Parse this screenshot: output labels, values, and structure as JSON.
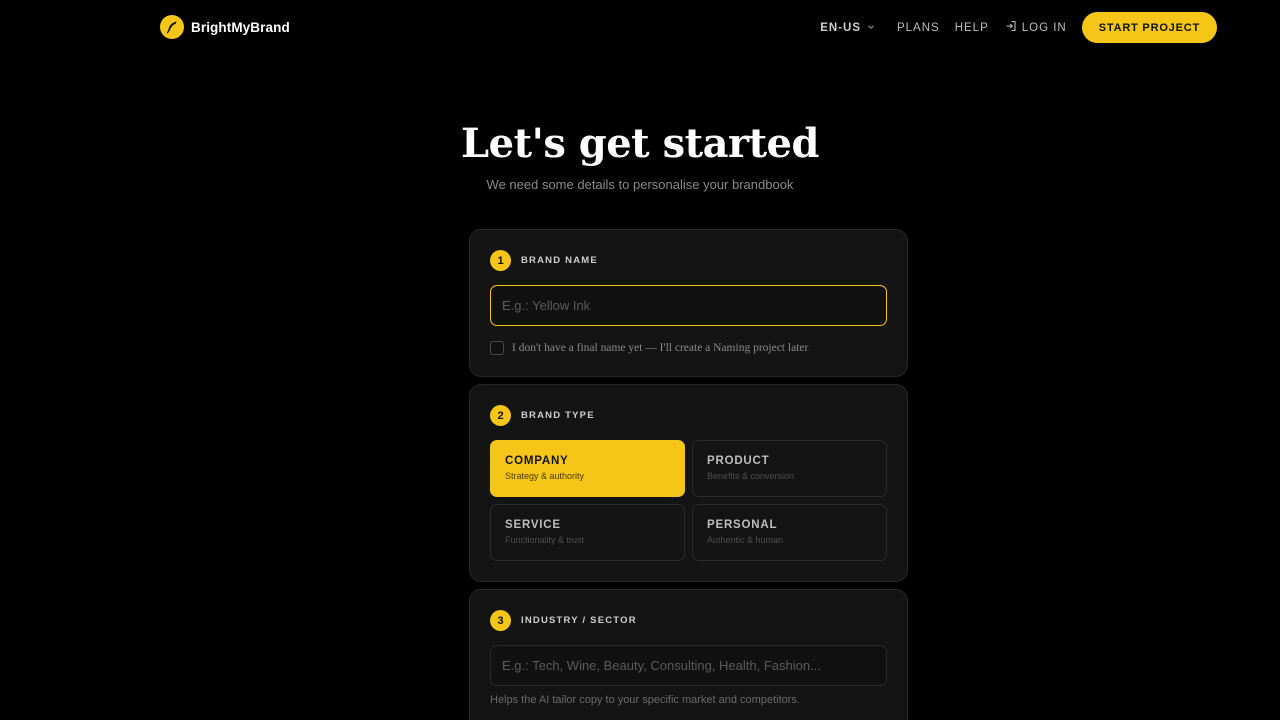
{
  "brand": {
    "name": "BrightMyBrand"
  },
  "nav": {
    "language": "EN-US",
    "plans": "PLANS",
    "help": "HELP",
    "login": "LOG IN",
    "cta": "START PROJECT"
  },
  "hero": {
    "title": "Let's get started",
    "subtitle": "We need some details to personalise your brandbook"
  },
  "steps": {
    "brand_name": {
      "number": "1",
      "label": "BRAND NAME",
      "placeholder": "E.g.: Yellow Ink",
      "value": "",
      "checkbox_label": "I don't have a final name yet — I'll create a Naming project later",
      "checkbox_checked": false
    },
    "brand_type": {
      "number": "2",
      "label": "BRAND TYPE",
      "options": [
        {
          "title": "COMPANY",
          "desc": "Strategy & authority",
          "selected": true
        },
        {
          "title": "PRODUCT",
          "desc": "Benefits & conversion",
          "selected": false
        },
        {
          "title": "SERVICE",
          "desc": "Functionality & trust",
          "selected": false
        },
        {
          "title": "PERSONAL",
          "desc": "Authentic & human",
          "selected": false
        }
      ]
    },
    "industry": {
      "number": "3",
      "label": "INDUSTRY / SECTOR",
      "placeholder": "E.g.: Tech, Wine, Beauty, Consulting, Health, Fashion...",
      "value": "",
      "helper": "Helps the AI tailor copy to your specific market and competitors."
    }
  },
  "icons": {
    "logo": "feather-icon",
    "language_dropdown": "chevron-down-icon",
    "login": "login-arrow-icon"
  },
  "colors": {
    "accent": "#f5c518",
    "background": "#000000",
    "card": "#141414"
  }
}
